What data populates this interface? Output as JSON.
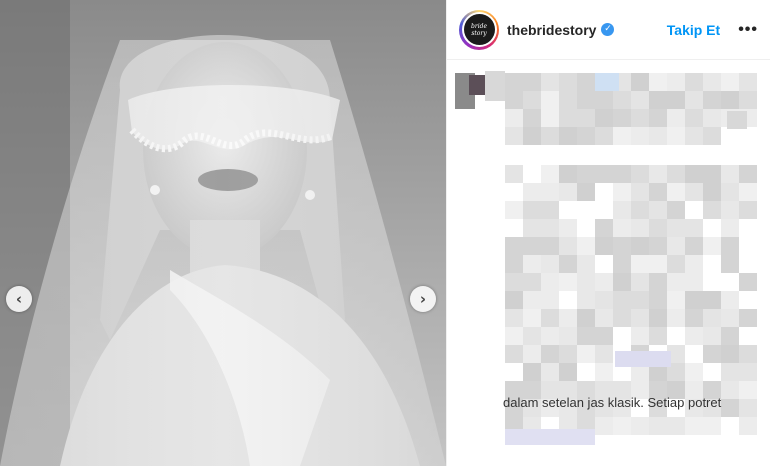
{
  "post": {
    "username": "thebridestory",
    "avatar_text": "bride story",
    "follow_label": "Takip Et",
    "more_label": "•••",
    "caption_tail": "dalam setelan jas klasik. Setiap potret"
  },
  "photo": {
    "prev_icon": "chevron-left-icon",
    "next_icon": "chevron-right-icon"
  },
  "colors": {
    "follow": "#0095f6",
    "verified": "#3897f0"
  }
}
